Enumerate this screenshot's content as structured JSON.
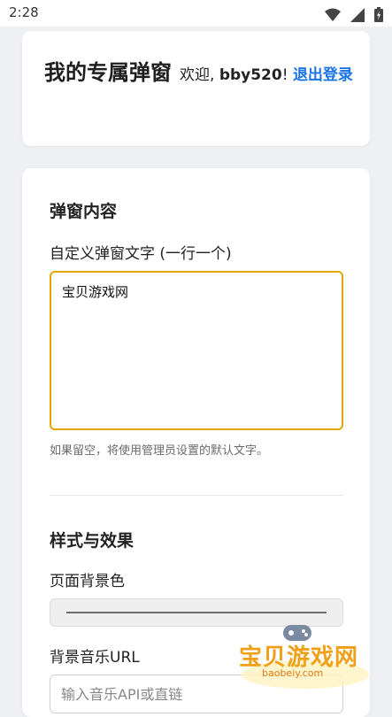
{
  "status_bar": {
    "time": "2:28"
  },
  "header": {
    "title": "我的专属弹窗",
    "welcome_prefix": "欢迎, ",
    "username": "bby520",
    "welcome_suffix": "! ",
    "logout_label": "退出登录"
  },
  "content_section": {
    "title": "弹窗内容",
    "textarea_label": "自定义弹窗文字 (一行一个)",
    "textarea_value": "宝贝游戏网",
    "help_text": "如果留空，将使用管理员设置的默认文字。"
  },
  "style_section": {
    "title": "样式与效果",
    "bg_color_label": "页面背景色",
    "music_label": "背景音乐URL",
    "music_placeholder": "输入音乐API或直链"
  },
  "watermark": {
    "text": "宝贝游戏网",
    "url": "baobeiy.com"
  },
  "colors": {
    "accent": "#1a73e8",
    "focus_border": "#e0a800",
    "background": "#eef0f3"
  }
}
